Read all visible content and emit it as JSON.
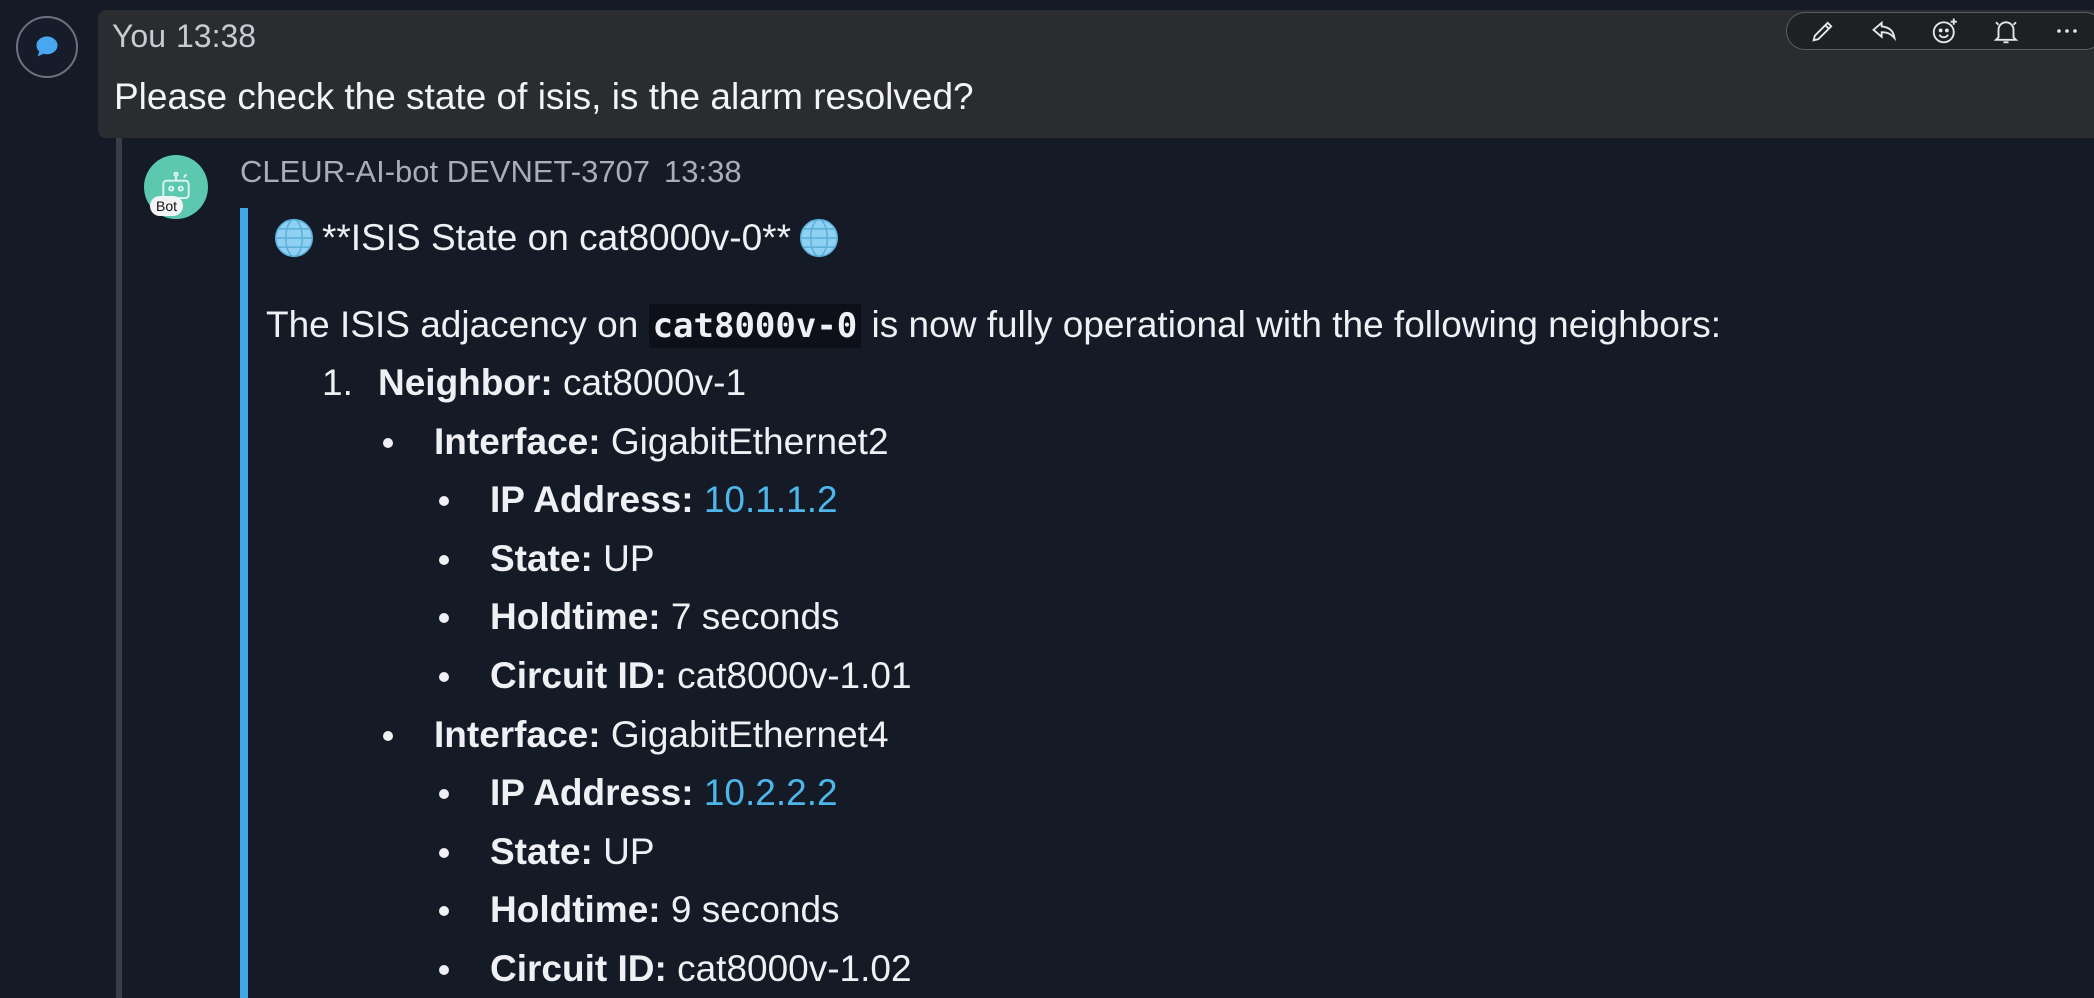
{
  "user_message": {
    "author": "You",
    "time": "13:38",
    "text": "Please check the state of isis, is the alarm resolved?"
  },
  "toolbar": {
    "icons": [
      "edit-icon",
      "reply-icon",
      "add-reaction-icon",
      "notification-bell-icon",
      "more-icon"
    ]
  },
  "bot_message": {
    "avatar_badge": "Bot",
    "author": "CLEUR-AI-bot DEVNET-3707",
    "time": "13:38",
    "title": "**ISIS State on cat8000v-0**",
    "intro_before": "The ISIS adjacency on ",
    "intro_code": "cat8000v-0",
    "intro_after": " is now fully operational with the following neighbors:",
    "neighbor": {
      "index": "1.",
      "label": "Neighbor:",
      "value": "cat8000v-1",
      "interfaces": [
        {
          "label": "Interface:",
          "value": "GigabitEthernet2",
          "ip_label": "IP Address:",
          "ip": "10.1.1.2",
          "state_label": "State:",
          "state": "UP",
          "holdtime_label": "Holdtime:",
          "holdtime": "7 seconds",
          "circuit_label": "Circuit ID:",
          "circuit": "cat8000v-1.01"
        },
        {
          "label": "Interface:",
          "value": "GigabitEthernet4",
          "ip_label": "IP Address:",
          "ip": "10.2.2.2",
          "state_label": "State:",
          "state": "UP",
          "holdtime_label": "Holdtime:",
          "holdtime": "9 seconds",
          "circuit_label": "Circuit ID:",
          "circuit": "cat8000v-1.02"
        }
      ]
    }
  },
  "colors": {
    "background": "#141a26",
    "user_bubble": "#2b2c2f",
    "quote_bar": "#41a9e6",
    "link": "#4fb6ea",
    "bot_avatar": "#5cc8b0"
  }
}
